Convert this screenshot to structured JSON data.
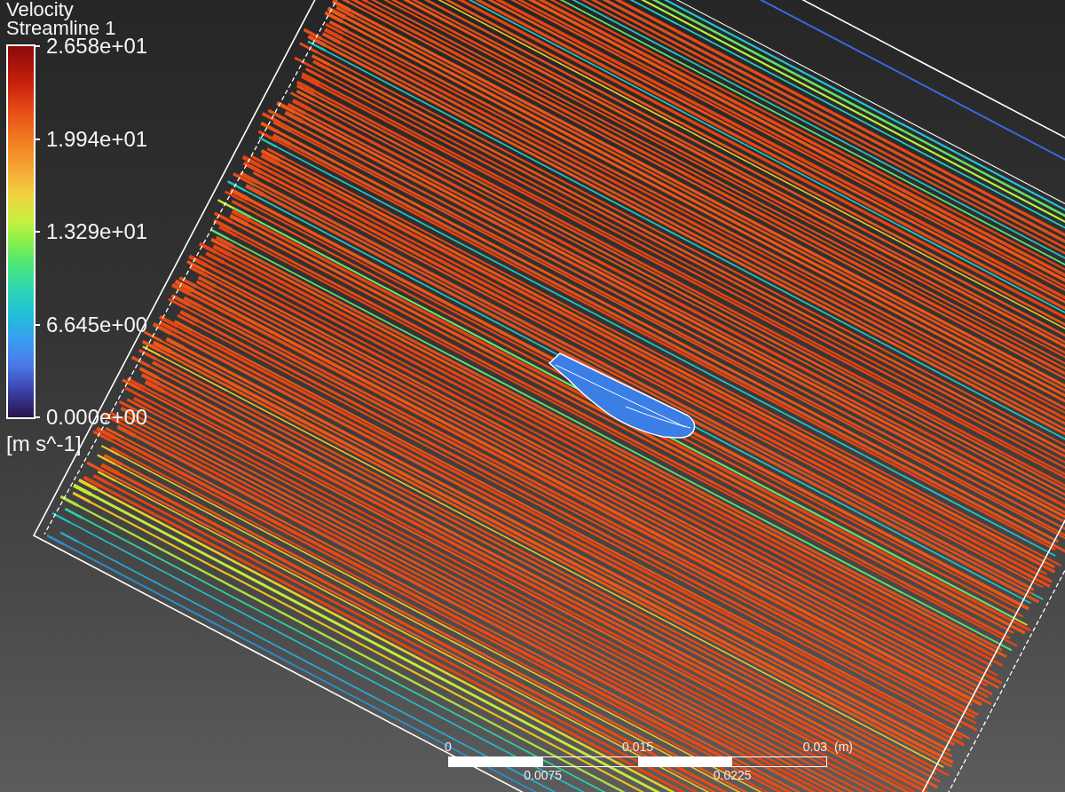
{
  "legend": {
    "title": "Velocity",
    "subtitle": "Streamline 1",
    "ticks": [
      "2.658e+01",
      "1.994e+01",
      "1.329e+01",
      "6.645e+00",
      "0.000e+00"
    ],
    "unit": "[m s^-1]"
  },
  "scale_bar": {
    "labels_above": [
      "0",
      "0.015",
      "0.03"
    ],
    "unit": "(m)",
    "labels_below": [
      "0.0075",
      "0.0225"
    ]
  }
}
